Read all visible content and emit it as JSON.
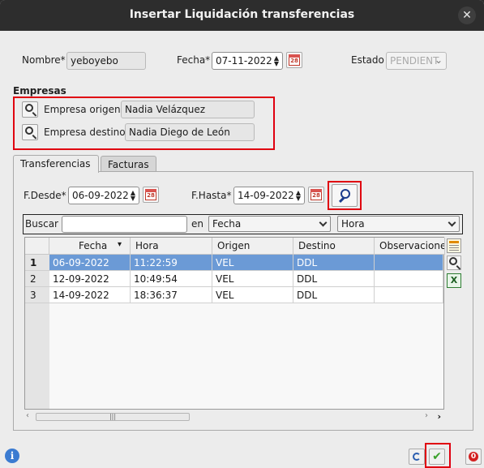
{
  "window": {
    "title": "Insertar Liquidación transferencias",
    "close_icon": "close-icon"
  },
  "form": {
    "nombre_label": "Nombre*",
    "nombre_value": "yeboyebo",
    "fecha_label": "Fecha*",
    "fecha_value": "07-11-2022",
    "estado_label": "Estado",
    "estado_value": "PENDIENT"
  },
  "empresas": {
    "section_label": "Empresas",
    "origen_label": "Empresa origen",
    "origen_value": "Nadia Velázquez",
    "destino_label": "Empresa destino",
    "destino_value": "Nadia Diego de León"
  },
  "tabs": [
    {
      "label": "Transferencias"
    },
    {
      "label": "Facturas"
    }
  ],
  "filters": {
    "desde_label": "F.Desde*",
    "desde_value": "06-09-2022",
    "hasta_label": "F.Hasta*",
    "hasta_value": "14-09-2022"
  },
  "search": {
    "buscar_label": "Buscar",
    "buscar_value": "",
    "en_label": "en",
    "field1": "Fecha",
    "field2": "Hora"
  },
  "calendar_label": "28",
  "grid": {
    "columns": [
      "Fecha",
      "Hora",
      "Origen",
      "Destino",
      "Observacione"
    ],
    "rows": [
      {
        "num": "1",
        "fecha": "06-09-2022",
        "hora": "11:22:59",
        "origen": "VEL",
        "destino": "DDL",
        "obs": ""
      },
      {
        "num": "2",
        "fecha": "12-09-2022",
        "hora": "10:49:54",
        "origen": "VEL",
        "destino": "DDL",
        "obs": ""
      },
      {
        "num": "3",
        "fecha": "14-09-2022",
        "hora": "18:36:37",
        "origen": "VEL",
        "destino": "DDL",
        "obs": ""
      }
    ]
  },
  "colors": {
    "accent": "#6b9ad6",
    "highlight_border": "#e00010",
    "titlebar": "#2d2d2d"
  }
}
